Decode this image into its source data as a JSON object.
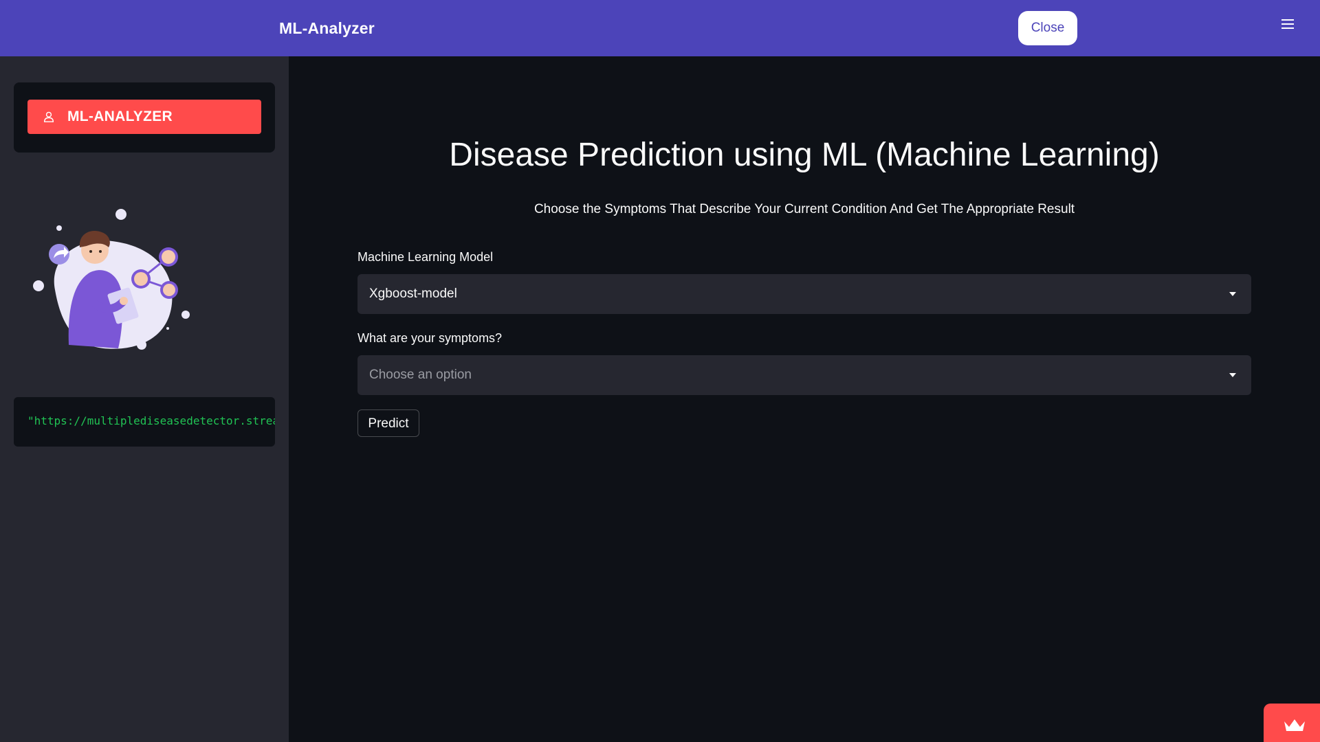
{
  "header": {
    "brand": "ML-Analyzer",
    "close_label": "Close",
    "menu_icon": "hamburger-icon",
    "bg_color": "#4c44b9"
  },
  "sidebar": {
    "nav_item": {
      "icon": "user-icon",
      "label": "ML-ANALYZER",
      "color": "#ff4b4b"
    },
    "illustration": "person-with-clipboard-network-illustration",
    "code_text": "\"https://multiplediseasedetector.strea"
  },
  "main": {
    "title": "Disease Prediction using ML (Machine Learning)",
    "subtitle": "Choose the Symptoms That Describe Your Current Condition And Get The Appropriate Result",
    "model_field": {
      "label": "Machine Learning Model",
      "value": "Xgboost-model"
    },
    "symptoms_field": {
      "label": "What are your symptoms?",
      "placeholder": "Choose an option"
    },
    "predict_label": "Predict"
  },
  "footer_badge": {
    "icon": "crown-icon"
  }
}
